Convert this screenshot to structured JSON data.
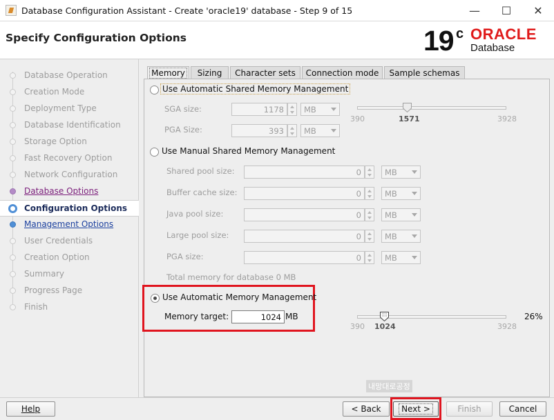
{
  "window": {
    "title": "Database Configuration Assistant - Create 'oracle19' database - Step 9 of 15",
    "minimize": "—",
    "maximize": "☐",
    "close": "✕"
  },
  "header": {
    "page_title": "Specify Configuration Options",
    "logo_version": "19",
    "logo_suffix": "c",
    "logo_brand": "ORACLE",
    "logo_product": "Database"
  },
  "nav": {
    "items": [
      {
        "label": "Database Operation",
        "state": "inactive"
      },
      {
        "label": "Creation Mode",
        "state": "inactive"
      },
      {
        "label": "Deployment Type",
        "state": "inactive"
      },
      {
        "label": "Database Identification",
        "state": "inactive"
      },
      {
        "label": "Storage Option",
        "state": "inactive"
      },
      {
        "label": "Fast Recovery Option",
        "state": "inactive"
      },
      {
        "label": "Network Configuration",
        "state": "inactive"
      },
      {
        "label": "Database Options",
        "state": "done"
      },
      {
        "label": "Configuration Options",
        "state": "current"
      },
      {
        "label": "Management Options",
        "state": "next"
      },
      {
        "label": "User Credentials",
        "state": "inactive"
      },
      {
        "label": "Creation Option",
        "state": "inactive"
      },
      {
        "label": "Summary",
        "state": "inactive"
      },
      {
        "label": "Progress Page",
        "state": "inactive"
      },
      {
        "label": "Finish",
        "state": "inactive"
      }
    ]
  },
  "tabs": [
    "Memory",
    "Sizing",
    "Character sets",
    "Connection mode",
    "Sample schemas"
  ],
  "memory": {
    "asmm": {
      "label": "Use Automatic Shared Memory Management",
      "selected": false,
      "sga_label": "SGA size:",
      "sga_value": "1178",
      "sga_unit": "MB",
      "pga_label": "PGA Size:",
      "pga_value": "393",
      "pga_unit": "MB",
      "slider_min": "390",
      "slider_value": "1571",
      "slider_max": "3928"
    },
    "manual": {
      "label": "Use Manual Shared Memory Management",
      "selected": false,
      "fields": [
        {
          "label": "Shared pool size:",
          "value": "0",
          "unit": "MB"
        },
        {
          "label": "Buffer cache size:",
          "value": "0",
          "unit": "MB"
        },
        {
          "label": "Java pool size:",
          "value": "0",
          "unit": "MB"
        },
        {
          "label": "Large pool size:",
          "value": "0",
          "unit": "MB"
        },
        {
          "label": "PGA size:",
          "value": "0",
          "unit": "MB"
        }
      ],
      "total": "Total memory for database 0 MB"
    },
    "amm": {
      "label": "Use Automatic Memory Management",
      "selected": true,
      "target_label": "Memory target:",
      "target_value": "1024",
      "target_unit": "MB",
      "slider_min": "390",
      "slider_value": "1024",
      "slider_max": "3928",
      "slider_fraction": 0.18,
      "percent": "26%"
    }
  },
  "watermark": "내망대로공정",
  "footer": {
    "help": "Help",
    "back": "< Back",
    "next": "Next >",
    "finish": "Finish",
    "cancel": "Cancel"
  },
  "colors": {
    "highlight": "#e0141e",
    "oracle_red": "#e01b1b"
  }
}
